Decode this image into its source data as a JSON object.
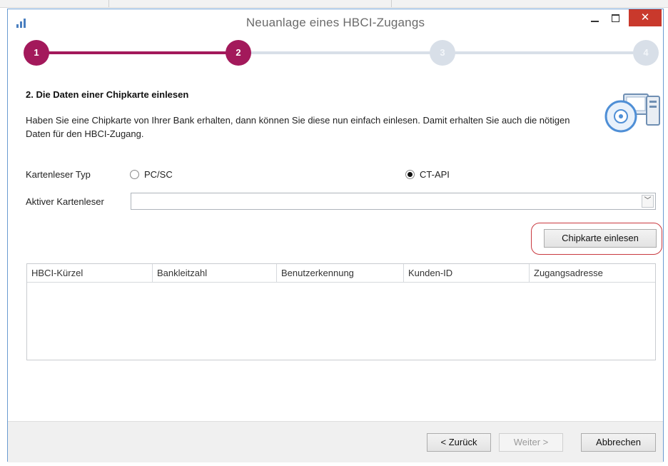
{
  "window": {
    "title": "Neuanlage eines HBCI-Zugangs",
    "close_glyph": "✕",
    "accent_color": "#a3195b"
  },
  "steps": [
    {
      "label": "1",
      "state": "done"
    },
    {
      "label": "2",
      "state": "current"
    },
    {
      "label": "3",
      "state": "pending"
    },
    {
      "label": "4",
      "state": "pending"
    }
  ],
  "section": {
    "title": "2. Die Daten einer Chipkarte einlesen",
    "description": "Haben Sie eine Chipkarte von Ihrer Bank erhalten, dann können Sie diese nun einfach einlesen. Damit erhalten Sie auch die nötigen Daten für den HBCI-Zugang."
  },
  "reader_type": {
    "label": "Kartenleser Typ",
    "options": [
      {
        "label": "PC/SC",
        "selected": false
      },
      {
        "label": "CT-API",
        "selected": true
      }
    ]
  },
  "active_reader": {
    "label": "Aktiver Kartenleser",
    "value": "",
    "arrow_glyph": "﹀"
  },
  "read_button": {
    "label": "Chipkarte einlesen"
  },
  "table": {
    "columns": [
      "HBCI-Kürzel",
      "Bankleitzahl",
      "Benutzerkennung",
      "Kunden-ID",
      "Zugangsadresse"
    ],
    "rows": []
  },
  "footer": {
    "back_label": "< Zurück",
    "next_label": "Weiter >",
    "cancel_label": "Abbrechen"
  }
}
